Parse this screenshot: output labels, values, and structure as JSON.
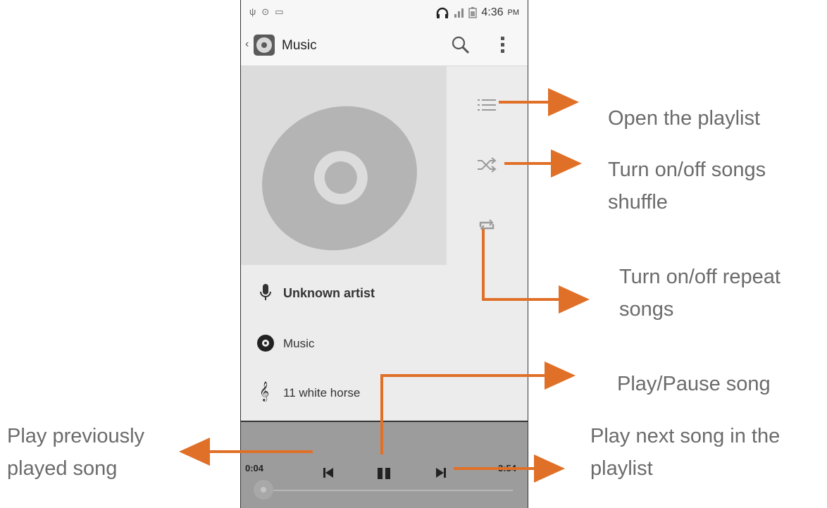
{
  "status_bar": {
    "time": "4:36",
    "ampm": "PM"
  },
  "action_bar": {
    "back_glyph": "‹",
    "title": "Music"
  },
  "track": {
    "artist": "Unknown artist",
    "album": "Music",
    "song": "11 white horse"
  },
  "playback": {
    "elapsed": "0:04",
    "duration": "3:54",
    "progress_fraction": 0.017
  },
  "callouts": {
    "playlist": "Open the playlist",
    "shuffle_line1": "Turn on/off songs",
    "shuffle_line2": "shuffle",
    "repeat_line1": "Turn on/off repeat",
    "repeat_line2": "songs",
    "playpause": "Play/Pause song",
    "prev_line1": "Play previously",
    "prev_line2": "played song",
    "next_line1": "Play next song in the",
    "next_line2": "playlist"
  },
  "colors": {
    "arrow": "#e07028",
    "callout_text": "#6b6b6b"
  },
  "icons": [
    "usb-icon",
    "sync-icon",
    "image-icon",
    "headphones-icon",
    "signal-icon",
    "battery-icon",
    "back-icon",
    "music-app-icon",
    "search-icon",
    "overflow-menu-icon",
    "playlist-icon",
    "shuffle-icon",
    "repeat-icon",
    "microphone-icon",
    "album-disc-icon",
    "treble-clef-icon",
    "previous-icon",
    "pause-icon",
    "next-icon"
  ]
}
